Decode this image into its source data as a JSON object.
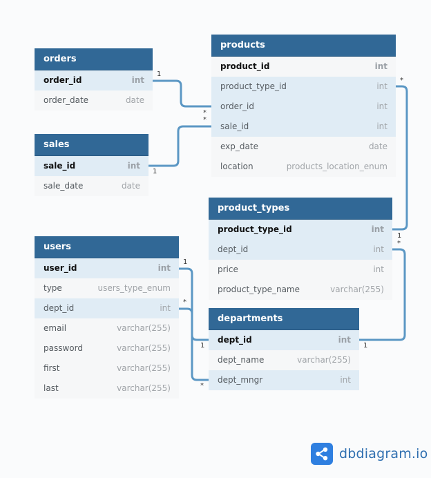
{
  "tables": {
    "orders": {
      "name": "orders",
      "fields": [
        {
          "name": "order_id",
          "type": "int"
        },
        {
          "name": "order_date",
          "type": "date"
        }
      ]
    },
    "sales": {
      "name": "sales",
      "fields": [
        {
          "name": "sale_id",
          "type": "int"
        },
        {
          "name": "sale_date",
          "type": "date"
        }
      ]
    },
    "products": {
      "name": "products",
      "fields": [
        {
          "name": "product_id",
          "type": "int"
        },
        {
          "name": "product_type_id",
          "type": "int"
        },
        {
          "name": "order_id",
          "type": "int"
        },
        {
          "name": "sale_id",
          "type": "int"
        },
        {
          "name": "exp_date",
          "type": "date"
        },
        {
          "name": "location",
          "type": "products_location_enum"
        }
      ]
    },
    "product_types": {
      "name": "product_types",
      "fields": [
        {
          "name": "product_type_id",
          "type": "int"
        },
        {
          "name": "dept_id",
          "type": "int"
        },
        {
          "name": "price",
          "type": "int"
        },
        {
          "name": "product_type_name",
          "type": "varchar(255)"
        }
      ]
    },
    "users": {
      "name": "users",
      "fields": [
        {
          "name": "user_id",
          "type": "int"
        },
        {
          "name": "type",
          "type": "users_type_enum"
        },
        {
          "name": "dept_id",
          "type": "int"
        },
        {
          "name": "email",
          "type": "varchar(255)"
        },
        {
          "name": "password",
          "type": "varchar(255)"
        },
        {
          "name": "first",
          "type": "varchar(255)"
        },
        {
          "name": "last",
          "type": "varchar(255)"
        }
      ]
    },
    "departments": {
      "name": "departments",
      "fields": [
        {
          "name": "dept_id",
          "type": "int"
        },
        {
          "name": "dept_name",
          "type": "varchar(255)"
        },
        {
          "name": "dept_mngr",
          "type": "int"
        }
      ]
    }
  },
  "cardinality": {
    "one": "1",
    "many": "*"
  },
  "brand": {
    "name": "dbdiagram.io"
  },
  "colors": {
    "header": "#316896",
    "link": "#5b97c4",
    "highlight_row": "#e0ecf5",
    "brand": "#2f7fe0"
  }
}
